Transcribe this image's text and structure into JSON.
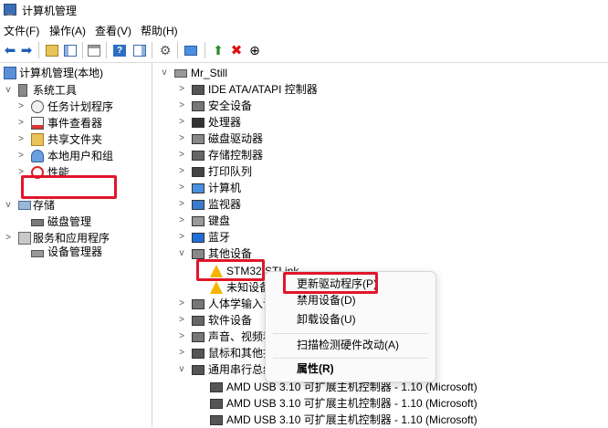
{
  "window": {
    "title": "计算机管理"
  },
  "menu": [
    "文件(F)",
    "操作(A)",
    "查看(V)",
    "帮助(H)"
  ],
  "toolbar": [
    "back-icon",
    "forward-icon",
    "folder-up-icon",
    "console-tree-icon",
    "properties-icon",
    "export-icon",
    "help-icon",
    "show-hide-icon",
    "scan-hardware-icon",
    "computer-icon",
    "enable-device-icon",
    "uninstall-icon",
    "update-driver-icon"
  ],
  "left_tree": {
    "root": "计算机管理(本地)",
    "system_tools": "系统工具",
    "task_scheduler": "任务计划程序",
    "event_viewer": "事件查看器",
    "shared_folders": "共享文件夹",
    "local_users": "本地用户和组",
    "performance": "性能",
    "device_manager": "设备管理器",
    "storage": "存储",
    "disk_management": "磁盘管理",
    "services": "服务和应用程序"
  },
  "right_tree": {
    "root": "Mr_Still",
    "ide": "IDE ATA/ATAPI 控制器",
    "security": "安全设备",
    "processors": "处理器",
    "disk_drives": "磁盘驱动器",
    "storage_controllers": "存储控制器",
    "print_queues": "打印队列",
    "computer": "计算机",
    "monitors": "监视器",
    "keyboards": "键盘",
    "bluetooth": "蓝牙",
    "other_devices": "其他设备",
    "stm32": "STM32 STLink",
    "unknown": "未知设备",
    "hid": "人体学输入设",
    "software_devices": "软件设备",
    "sound": "声音、视频和",
    "mice": "鼠标和其他指",
    "usb_controllers": "通用串行总线",
    "amd_usb_1": "AMD USB 3.10 可扩展主机控制器 - 1.10 (Microsoft)",
    "amd_usb_2": "AMD USB 3.10 可扩展主机控制器 - 1.10 (Microsoft)",
    "amd_usb_3": "AMD USB 3.10 可扩展主机控制器 - 1.10 (Microsoft)"
  },
  "context_menu": {
    "update_driver": "更新驱动程序(P)",
    "disable_device": "禁用设备(D)",
    "uninstall_device": "卸载设备(U)",
    "scan_hardware": "扫描检测硬件改动(A)",
    "properties": "属性(R)"
  },
  "colors": {
    "highlight": "#e0162b",
    "selection": "#cce8ff",
    "warning": "#f5b400"
  }
}
